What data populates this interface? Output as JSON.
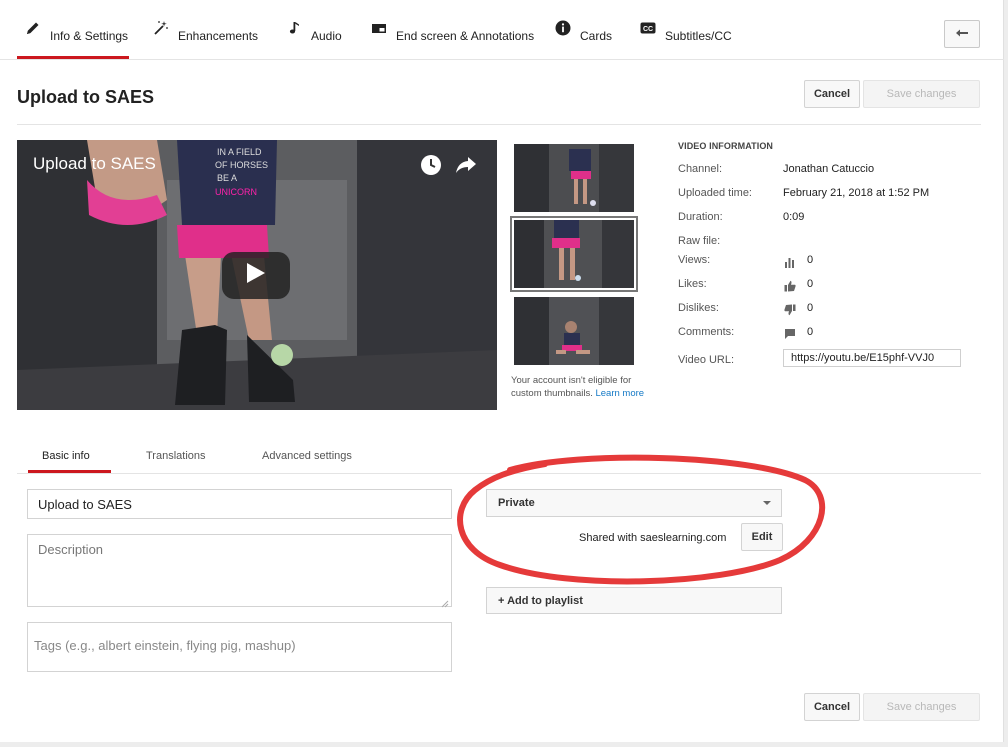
{
  "tabs": [
    {
      "label": "Info & Settings",
      "icon": "pencil-icon",
      "active": true
    },
    {
      "label": "Enhancements",
      "icon": "magic-wand-icon"
    },
    {
      "label": "Audio",
      "icon": "music-note-icon"
    },
    {
      "label": "End screen & Annotations",
      "icon": "end-screen-icon"
    },
    {
      "label": "Cards",
      "icon": "info-icon"
    },
    {
      "label": "Subtitles/CC",
      "icon": "cc-icon"
    }
  ],
  "header": {
    "title": "Upload to SAES",
    "cancel_label": "Cancel",
    "save_label": "Save changes"
  },
  "video": {
    "title": "Upload to SAES"
  },
  "thumbnails": {
    "note": "Your account isn't eligible for custom thumbnails.",
    "learn_more": "Learn more"
  },
  "video_info": {
    "heading": "VIDEO INFORMATION",
    "channel_label": "Channel:",
    "channel": "Jonathan Catuccio",
    "uploaded_label": "Uploaded time:",
    "uploaded": "February 21, 2018 at 1:52 PM",
    "duration_label": "Duration:",
    "duration": "0:09",
    "raw_file_label": "Raw file:",
    "views_label": "Views:",
    "views": "0",
    "likes_label": "Likes:",
    "likes": "0",
    "dislikes_label": "Dislikes:",
    "dislikes": "0",
    "comments_label": "Comments:",
    "comments": "0",
    "url_label": "Video URL:",
    "url": "https://youtu.be/E15phf-VVJ0"
  },
  "subtabs": [
    {
      "label": "Basic info",
      "active": true
    },
    {
      "label": "Translations"
    },
    {
      "label": "Advanced settings"
    }
  ],
  "form": {
    "title_value": "Upload to SAES",
    "description_placeholder": "Description",
    "tags_placeholder": "Tags (e.g., albert einstein, flying pig, mashup)",
    "privacy": "Private",
    "shared_with": "Shared with saeslearning.com",
    "edit_label": "Edit",
    "playlist_label": "+ Add to playlist"
  },
  "footer": {
    "cancel_label": "Cancel",
    "save_label": "Save changes"
  },
  "colors": {
    "accent": "#cc181e",
    "link": "#167ac6",
    "annotation": "#e53a3a"
  }
}
